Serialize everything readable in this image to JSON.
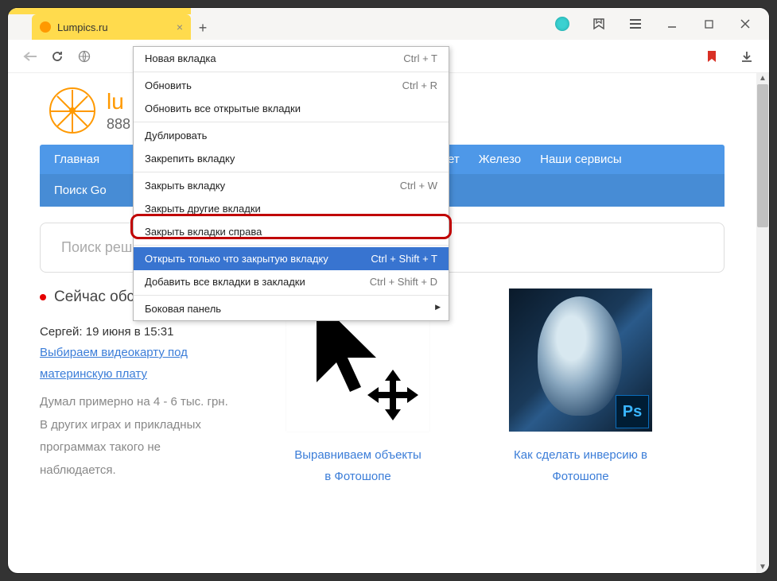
{
  "browser": {
    "tab": {
      "title": "Lumpics.ru"
    },
    "window_controls": {
      "zen": "zen",
      "favorites": "favorites",
      "menu": "menu",
      "min": "minimize",
      "max": "maximize",
      "close": "close"
    },
    "address_bar": {
      "back": "back",
      "forward": "forward",
      "reload": "reload",
      "globe": "site-info",
      "bookmark": "bookmark",
      "downloads": "downloads"
    }
  },
  "context_menu": {
    "items": [
      {
        "label": "Новая вкладка",
        "shortcut": "Ctrl + T"
      },
      {
        "label": "Обновить",
        "shortcut": "Ctrl + R"
      },
      {
        "label": "Обновить все открытые вкладки",
        "shortcut": ""
      },
      {
        "label": "Дублировать",
        "shortcut": ""
      },
      {
        "label": "Закрепить вкладку",
        "shortcut": ""
      },
      {
        "label": "Закрыть вкладку",
        "shortcut": "Ctrl + W"
      },
      {
        "label": "Закрыть другие вкладки",
        "shortcut": ""
      },
      {
        "label": "Закрыть вкладки справа",
        "shortcut": ""
      },
      {
        "label": "Открыть только что закрытую вкладку",
        "shortcut": "Ctrl + Shift + T",
        "highlighted": true
      },
      {
        "label": "Добавить все вкладки в закладки",
        "shortcut": "Ctrl + Shift + D"
      },
      {
        "label": "Боковая панель",
        "shortcut": "",
        "submenu": true
      }
    ]
  },
  "site": {
    "name_fragment": "lu",
    "phone": "888",
    "nav_top": {
      "home": "Главная",
      "internet": "ернет",
      "hardware": "Железо",
      "services": "Наши сервисы"
    },
    "nav_bottom": {
      "search_g": "Поиск Go"
    },
    "search_placeholder": "Поиск решения…"
  },
  "discussion": {
    "header": "Сейчас обсуждаем",
    "author": "Сергей",
    "meta_sep": ": ",
    "date": "19 июня в 15:31",
    "link": "Выбираем видеокарту под материнскую плату",
    "body": "Думал примерно на 4 - 6 тыс. грн. В других играх и прикладных программах такого не наблюдается."
  },
  "cards": {
    "c1": {
      "title_l1": "Выравниваем объекты",
      "title_l2": "в Фотошопе"
    },
    "c2": {
      "title_l1": "Как сделать инверсию в",
      "title_l2": "Фотошопе",
      "badge": "Ps"
    }
  }
}
